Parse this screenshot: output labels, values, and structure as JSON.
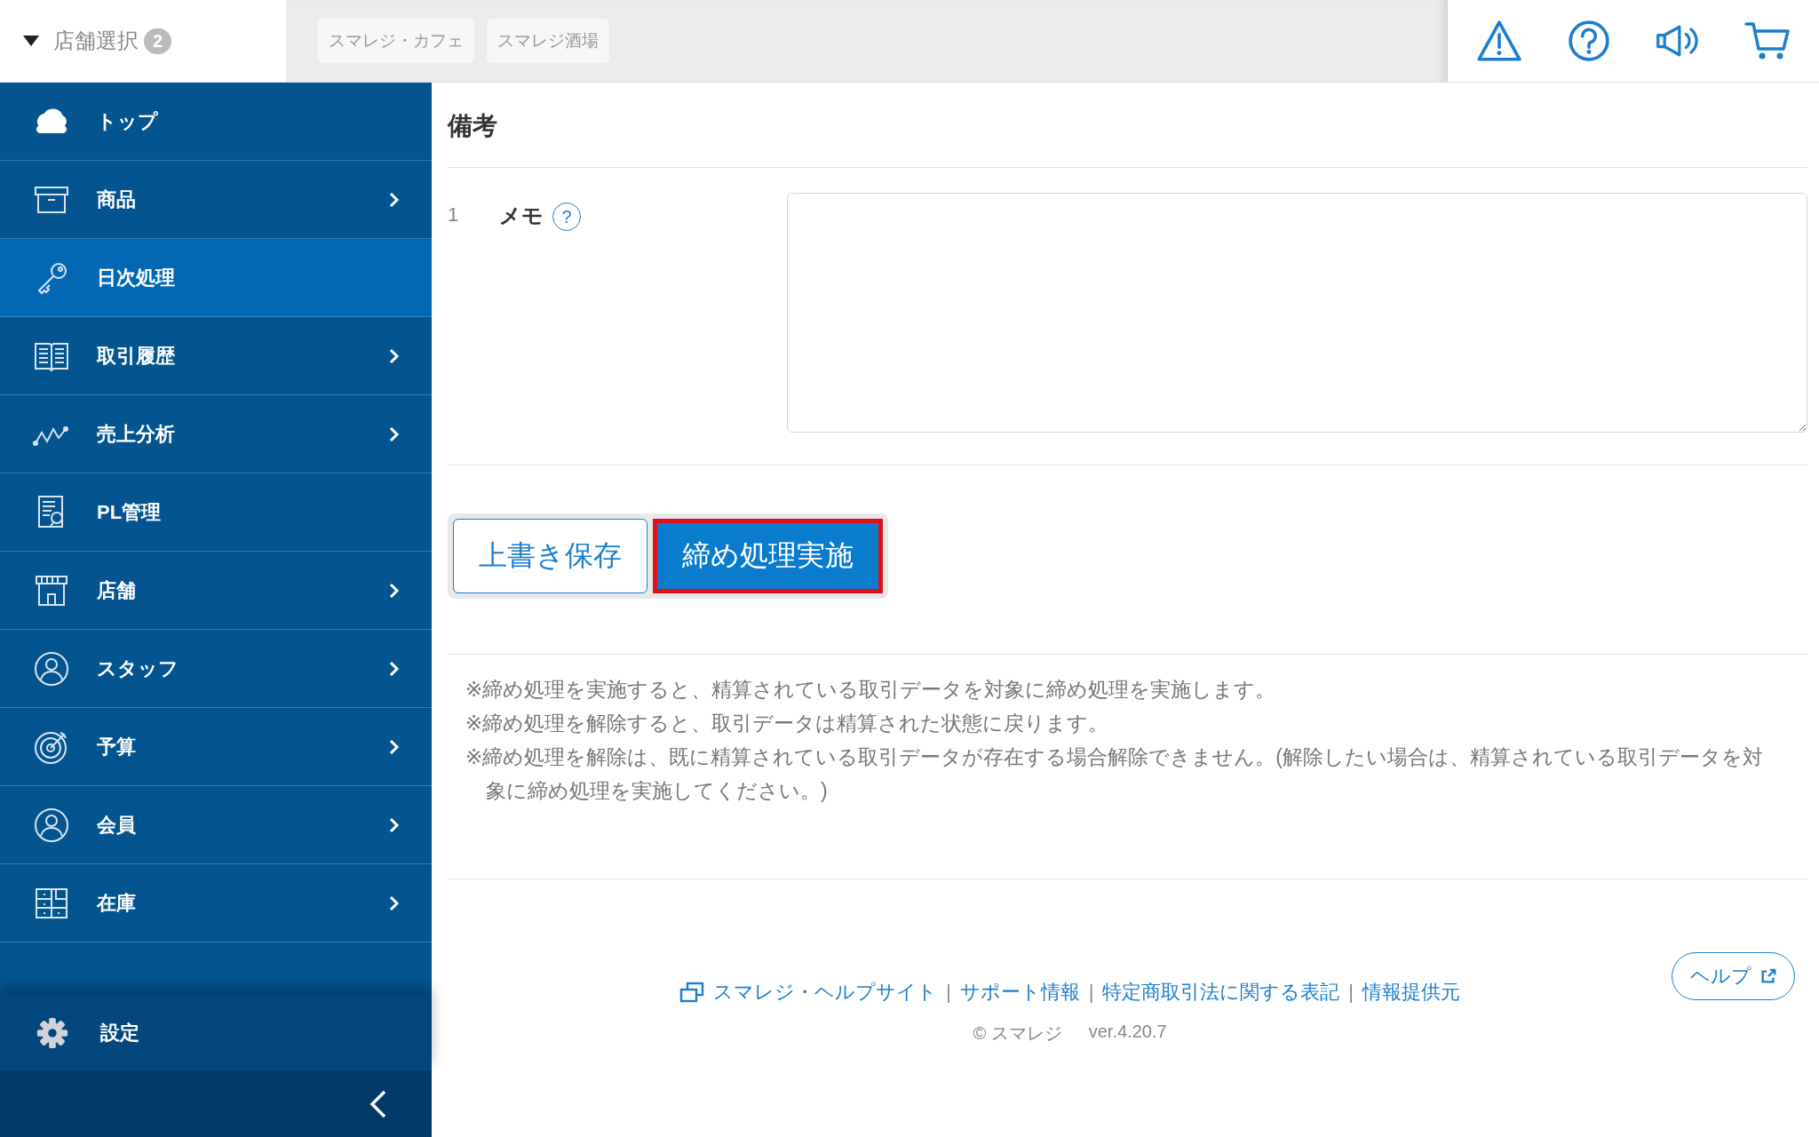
{
  "store_select": {
    "label": "店舗選択",
    "count": "2",
    "expanded": true
  },
  "store_tags": [
    "スマレジ・カフェ",
    "スマレジ酒場"
  ],
  "sidebar": {
    "items": [
      {
        "label": "トップ",
        "has_submenu": false,
        "selected": false
      },
      {
        "label": "商品",
        "has_submenu": true,
        "selected": false
      },
      {
        "label": "日次処理",
        "has_submenu": false,
        "selected": true
      },
      {
        "label": "取引履歴",
        "has_submenu": true,
        "selected": false
      },
      {
        "label": "売上分析",
        "has_submenu": true,
        "selected": false
      },
      {
        "label": "PL管理",
        "has_submenu": false,
        "selected": false
      },
      {
        "label": "店舗",
        "has_submenu": true,
        "selected": false
      },
      {
        "label": "スタッフ",
        "has_submenu": true,
        "selected": false
      },
      {
        "label": "予算",
        "has_submenu": true,
        "selected": false
      },
      {
        "label": "会員",
        "has_submenu": true,
        "selected": false
      },
      {
        "label": "在庫",
        "has_submenu": true,
        "selected": false
      }
    ],
    "settings": "設定"
  },
  "section": {
    "title": "備考",
    "fields": [
      {
        "number": "1",
        "label": "メモ",
        "help": "?"
      }
    ]
  },
  "buttons": [
    {
      "label": "上書き保存",
      "kind": "secondary",
      "highlighted": false
    },
    {
      "label": "締め処理実施",
      "kind": "primary",
      "highlighted": true
    }
  ],
  "notes": [
    "※締め処理を実施すると、精算されている取引データを対象に締め処理を実施します。",
    "※締め処理を解除すると、取引データは精算された状態に戻ります。",
    "※締め処理を解除は、既に精算されている取引データが存在する場合解除できません。(解除したい場合は、精算されている取引データを対象に締め処理を実施してください。)"
  ],
  "footer": {
    "items": [
      {
        "kind": "link",
        "text": "スマレジ・ヘルプサイト"
      },
      {
        "kind": "separator",
        "text": "|"
      },
      {
        "kind": "link",
        "text": "サポート情報"
      },
      {
        "kind": "separator",
        "text": "|"
      },
      {
        "kind": "link",
        "text": "特定商取引法に関する表記"
      },
      {
        "kind": "separator",
        "text": "|"
      },
      {
        "kind": "link",
        "text": "情報提供元"
      }
    ],
    "copyright": "© スマレジ",
    "version": "ver.4.20.7",
    "help_button": "ヘルプ"
  }
}
